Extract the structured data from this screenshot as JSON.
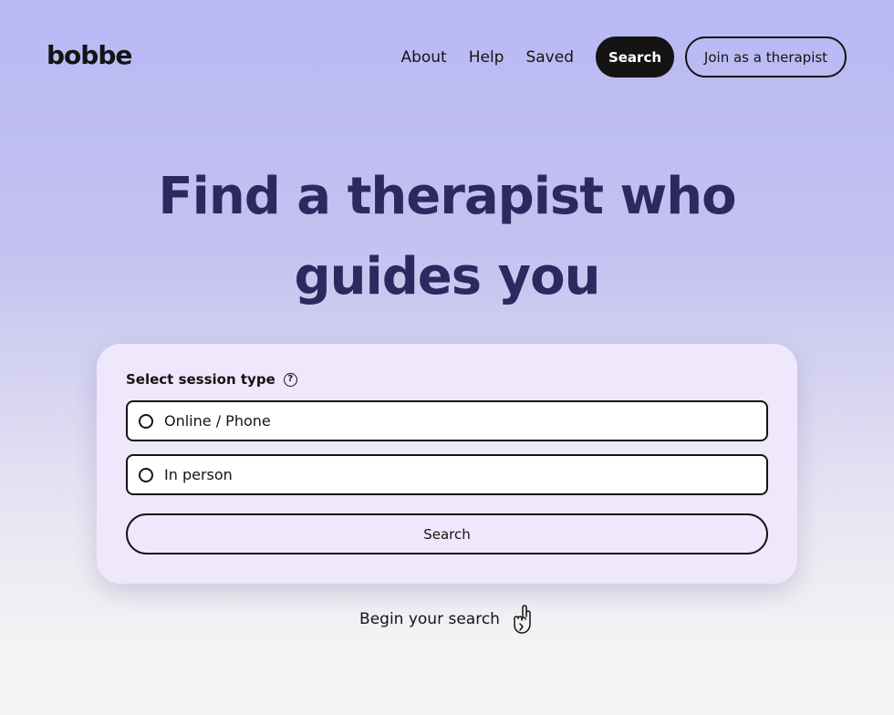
{
  "brand": {
    "logo": "bobbe"
  },
  "nav": {
    "about": "About",
    "help": "Help",
    "saved": "Saved",
    "search": "Search",
    "join": "Join as a therapist"
  },
  "hero": {
    "title_line1": "Find a therapist who",
    "title_line2": "guides you"
  },
  "form": {
    "label": "Select session type",
    "help_icon": "question-circle-icon",
    "options": [
      {
        "label": "Online / Phone",
        "selected": false
      },
      {
        "label": "In person",
        "selected": false
      }
    ],
    "submit": "Search"
  },
  "footer_hint": {
    "text": "Begin your search",
    "icon": "pointing-hand-icon"
  },
  "colors": {
    "title": "#2e2860",
    "card": "#efe8fc",
    "primary_button": "#141414"
  }
}
